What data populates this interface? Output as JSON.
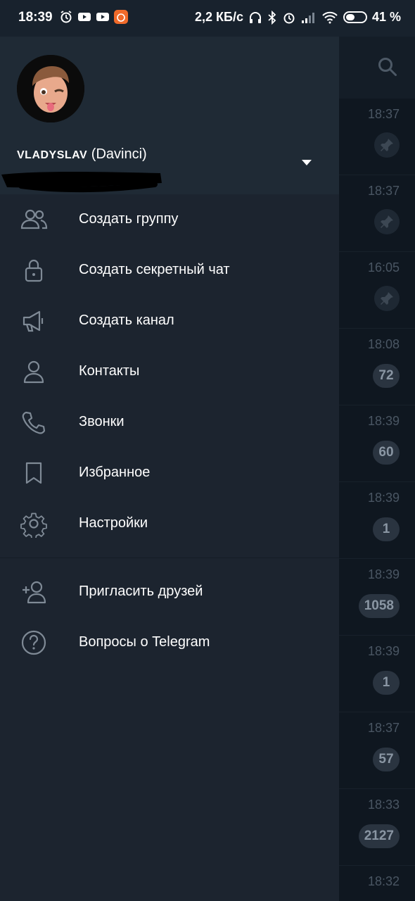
{
  "status_bar": {
    "time": "18:39",
    "speed": "2,2 КБ/с",
    "battery_percent": "41 %",
    "battery_level": 0.41
  },
  "drawer": {
    "username": "VLADYSLAV",
    "nickname": "(Davinci)",
    "menu": [
      {
        "label": "Создать группу",
        "icon": "group-icon"
      },
      {
        "label": "Создать секретный чат",
        "icon": "lock-icon"
      },
      {
        "label": "Создать канал",
        "icon": "megaphone-icon"
      },
      {
        "label": "Контакты",
        "icon": "contact-icon"
      },
      {
        "label": "Звонки",
        "icon": "phone-icon"
      },
      {
        "label": "Избранное",
        "icon": "bookmark-icon"
      },
      {
        "label": "Настройки",
        "icon": "gear-icon"
      }
    ],
    "menu2": [
      {
        "label": "Пригласить друзей",
        "icon": "add-user-icon"
      },
      {
        "label": "Вопросы о Telegram",
        "icon": "help-icon"
      }
    ]
  },
  "chat_list": [
    {
      "time": "18:37",
      "badge": "",
      "pinned": true
    },
    {
      "time": "18:37",
      "badge": "",
      "pinned": true
    },
    {
      "time": "16:05",
      "badge": "",
      "pinned": true
    },
    {
      "time": "18:08",
      "badge": "72",
      "pinned": false
    },
    {
      "time": "18:39",
      "badge": "60",
      "pinned": false
    },
    {
      "time": "18:39",
      "badge": "1",
      "pinned": false
    },
    {
      "time": "18:39",
      "badge": "1058",
      "pinned": false
    },
    {
      "time": "18:39",
      "badge": "1",
      "pinned": false
    },
    {
      "time": "18:37",
      "badge": "57",
      "pinned": false
    },
    {
      "time": "18:33",
      "badge": "2127",
      "pinned": false
    },
    {
      "time": "18:32",
      "badge": "",
      "pinned": false
    }
  ]
}
